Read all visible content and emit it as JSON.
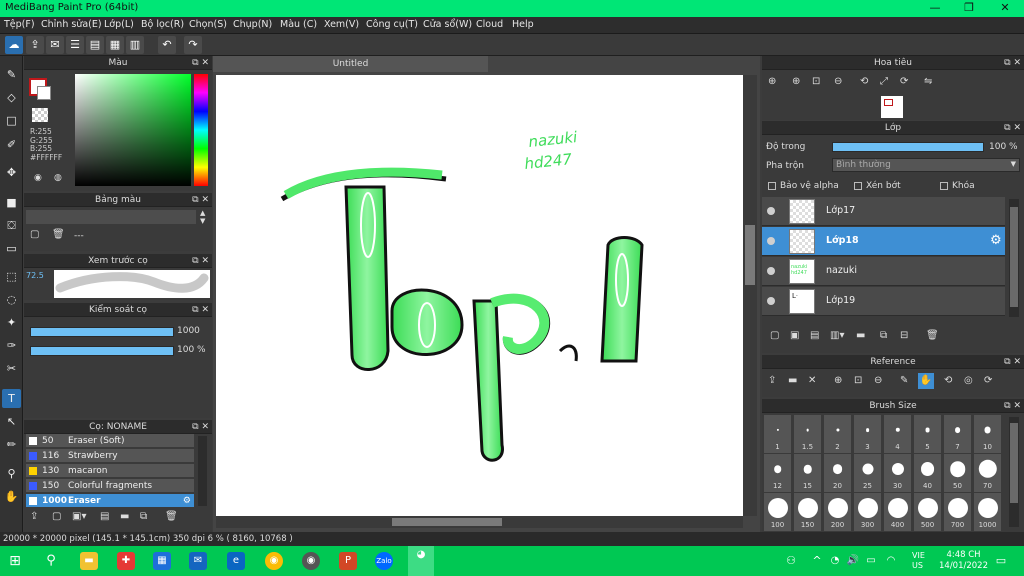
{
  "app": {
    "title": "MediBang Paint Pro (64bit)"
  },
  "window_buttons": {
    "minimize": "—",
    "maximize": "❐",
    "close": "✕"
  },
  "menu": [
    "Tệp(F)",
    "Chỉnh sửa(E)",
    "Lớp(L)",
    "Bộ lọc(R)",
    "Chọn(S)",
    "Chụp(N)",
    "Màu (C)",
    "Xem(V)",
    "Công cụ(T)",
    "Cửa sổ(W)",
    "Cloud",
    "Help"
  ],
  "canvas": {
    "tab": "Untitled",
    "signature_line1": "nazuki",
    "signature_line2": "hd247"
  },
  "color_panel": {
    "title": "Màu",
    "r": "R:255",
    "g": "G:255",
    "b": "B:255",
    "hex": "#FFFFFF"
  },
  "palette_panel": {
    "title": "Bảng màu",
    "placeholder": "---"
  },
  "brush_preview": {
    "title": "Xem trước cọ",
    "size": "72.5"
  },
  "brush_control": {
    "title": "Kiểm soát cọ",
    "size_value": "1000",
    "opacity_value": "100 %",
    "size_fraction": 1.0,
    "opacity_fraction": 1.0
  },
  "brush_list": {
    "title": "Cọ: NONAME",
    "items": [
      {
        "size": "50",
        "name": "Eraser (Soft)",
        "color": "#ffffff"
      },
      {
        "size": "116",
        "name": "Strawberry",
        "color": "#3b5bff"
      },
      {
        "size": "130",
        "name": "macaron",
        "color": "#ffd200"
      },
      {
        "size": "150",
        "name": "Colorful fragments",
        "color": "#3b5bff"
      },
      {
        "size": "1000",
        "name": "Eraser",
        "color": "#ffffff"
      }
    ]
  },
  "navigator": {
    "title": "Hoa tiêu"
  },
  "layer_panel": {
    "title": "Lớp",
    "opacity_label": "Độ trong",
    "opacity_value": "100 %",
    "opacity_fraction": 1.0,
    "blend_label": "Pha trộn",
    "blend_value": "Bình thường",
    "protect_alpha": "Bảo vệ alpha",
    "clipping": "Xén bớt",
    "lock": "Khóa",
    "layers": [
      {
        "name": "Lớp17",
        "thumb": ""
      },
      {
        "name": "Lớp18",
        "thumb": ""
      },
      {
        "name": "nazuki",
        "thumb": "nazuki hd247"
      },
      {
        "name": "Lớp19",
        "thumb": ""
      }
    ]
  },
  "reference_panel": {
    "title": "Reference"
  },
  "brush_size_panel": {
    "title": "Brush Size",
    "sizes": [
      "1",
      "1.5",
      "2",
      "3",
      "4",
      "5",
      "7",
      "10",
      "12",
      "15",
      "20",
      "25",
      "30",
      "40",
      "50",
      "70",
      "100",
      "150",
      "200",
      "300",
      "400",
      "500",
      "700",
      "1000"
    ]
  },
  "status": {
    "text": "20000 * 20000 pixel  (145.1 * 145.1cm)  350 dpi  6 %  ( 8160, 10768 )"
  },
  "taskbar": {
    "lang1": "VIE",
    "lang2": "US",
    "time": "4:48 CH",
    "date": "14/01/2022"
  }
}
